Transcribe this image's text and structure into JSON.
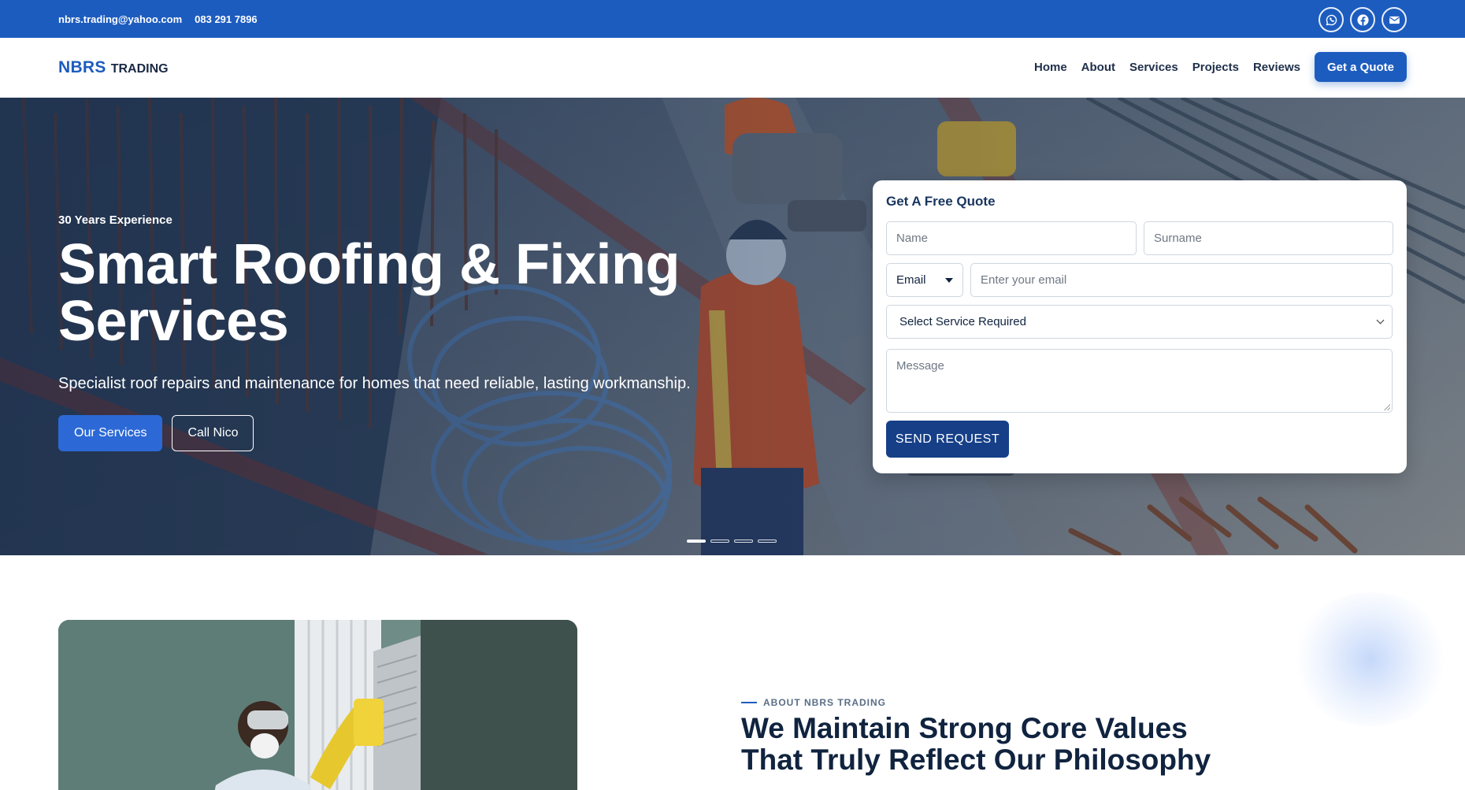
{
  "topbar": {
    "email": "nbrs.trading@yahoo.com",
    "phone": "083 291 7896",
    "socials": [
      "whatsapp-icon",
      "facebook-icon",
      "mail-icon"
    ],
    "color": "#1d5cbf"
  },
  "nav": {
    "logo_main": "NBRS",
    "logo_sub": "TRADING",
    "items": [
      {
        "label": "Home"
      },
      {
        "label": "About"
      },
      {
        "label": "Services"
      },
      {
        "label": "Projects"
      },
      {
        "label": "Reviews"
      }
    ],
    "cta": "Get a Quote"
  },
  "hero": {
    "eyebrow": "30 Years Experience",
    "title_line1": "Smart Roofing & Fixing",
    "title_line2": "Services",
    "subtitle": "Specialist roof repairs and maintenance for homes that need reliable, lasting workmanship.",
    "primary_button": "Our Services",
    "secondary_button": "Call Nico",
    "slides": 4,
    "active_slide": 1
  },
  "quote_form": {
    "title": "Get A Free Quote",
    "name_placeholder": "Name",
    "surname_placeholder": "Surname",
    "contact_method": "Email",
    "email_placeholder": "Enter your email",
    "service_select": "Select Service Required",
    "message_placeholder": "Message",
    "submit": "SEND REQUEST"
  },
  "about": {
    "tag": "ABOUT NBRS TRADING",
    "title_line1": "We Maintain Strong Core Values",
    "title_line2": "That Truly Reflect Our Philosophy"
  },
  "colors": {
    "brand": "#1d5cbf",
    "navy": "#10233f",
    "submit": "#163f88"
  }
}
